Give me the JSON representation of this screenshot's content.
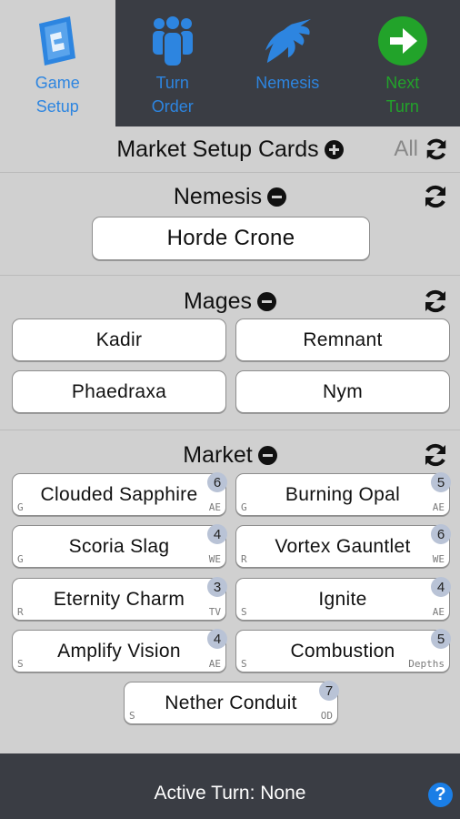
{
  "nav": {
    "tabs": [
      {
        "line1": "Game",
        "line2": "Setup",
        "color": "#2d85e0",
        "icon": "game-setup-icon",
        "active": true
      },
      {
        "line1": "Turn",
        "line2": "Order",
        "color": "#2d85e0",
        "icon": "turn-order-icon",
        "active": false
      },
      {
        "line1": "Nemesis",
        "line2": "",
        "color": "#2d85e0",
        "icon": "nemesis-icon",
        "active": false
      },
      {
        "line1": "Next",
        "line2": "Turn",
        "color": "#22a32a",
        "icon": "next-turn-icon",
        "active": false
      }
    ]
  },
  "market_setup": {
    "title": "Market Setup Cards",
    "all_label": "All"
  },
  "nemesis": {
    "title": "Nemesis",
    "card": "Horde Crone"
  },
  "mages": {
    "title": "Mages",
    "cards": [
      "Kadir",
      "Remnant",
      "Phaedraxa",
      "Nym"
    ]
  },
  "market": {
    "title": "Market",
    "cards": [
      {
        "name": "Clouded Sapphire",
        "cost": "6",
        "type": "G",
        "set": "AE"
      },
      {
        "name": "Burning Opal",
        "cost": "5",
        "type": "G",
        "set": "AE"
      },
      {
        "name": "Scoria Slag",
        "cost": "4",
        "type": "G",
        "set": "WE"
      },
      {
        "name": "Vortex Gauntlet",
        "cost": "6",
        "type": "R",
        "set": "WE"
      },
      {
        "name": "Eternity Charm",
        "cost": "3",
        "type": "R",
        "set": "TV"
      },
      {
        "name": "Ignite",
        "cost": "4",
        "type": "S",
        "set": "AE"
      },
      {
        "name": "Amplify Vision",
        "cost": "4",
        "type": "S",
        "set": "AE"
      },
      {
        "name": "Combustion",
        "cost": "5",
        "type": "S",
        "set": "Depths"
      },
      {
        "name": "Nether Conduit",
        "cost": "7",
        "type": "S",
        "set": "OD"
      }
    ]
  },
  "footer": {
    "status": "Active Turn: None",
    "help": "?"
  },
  "colors": {
    "nav_bg": "#3a3d44",
    "accent_blue": "#2d85e0",
    "accent_green": "#22a32a",
    "badge": "#b9c3d6"
  }
}
